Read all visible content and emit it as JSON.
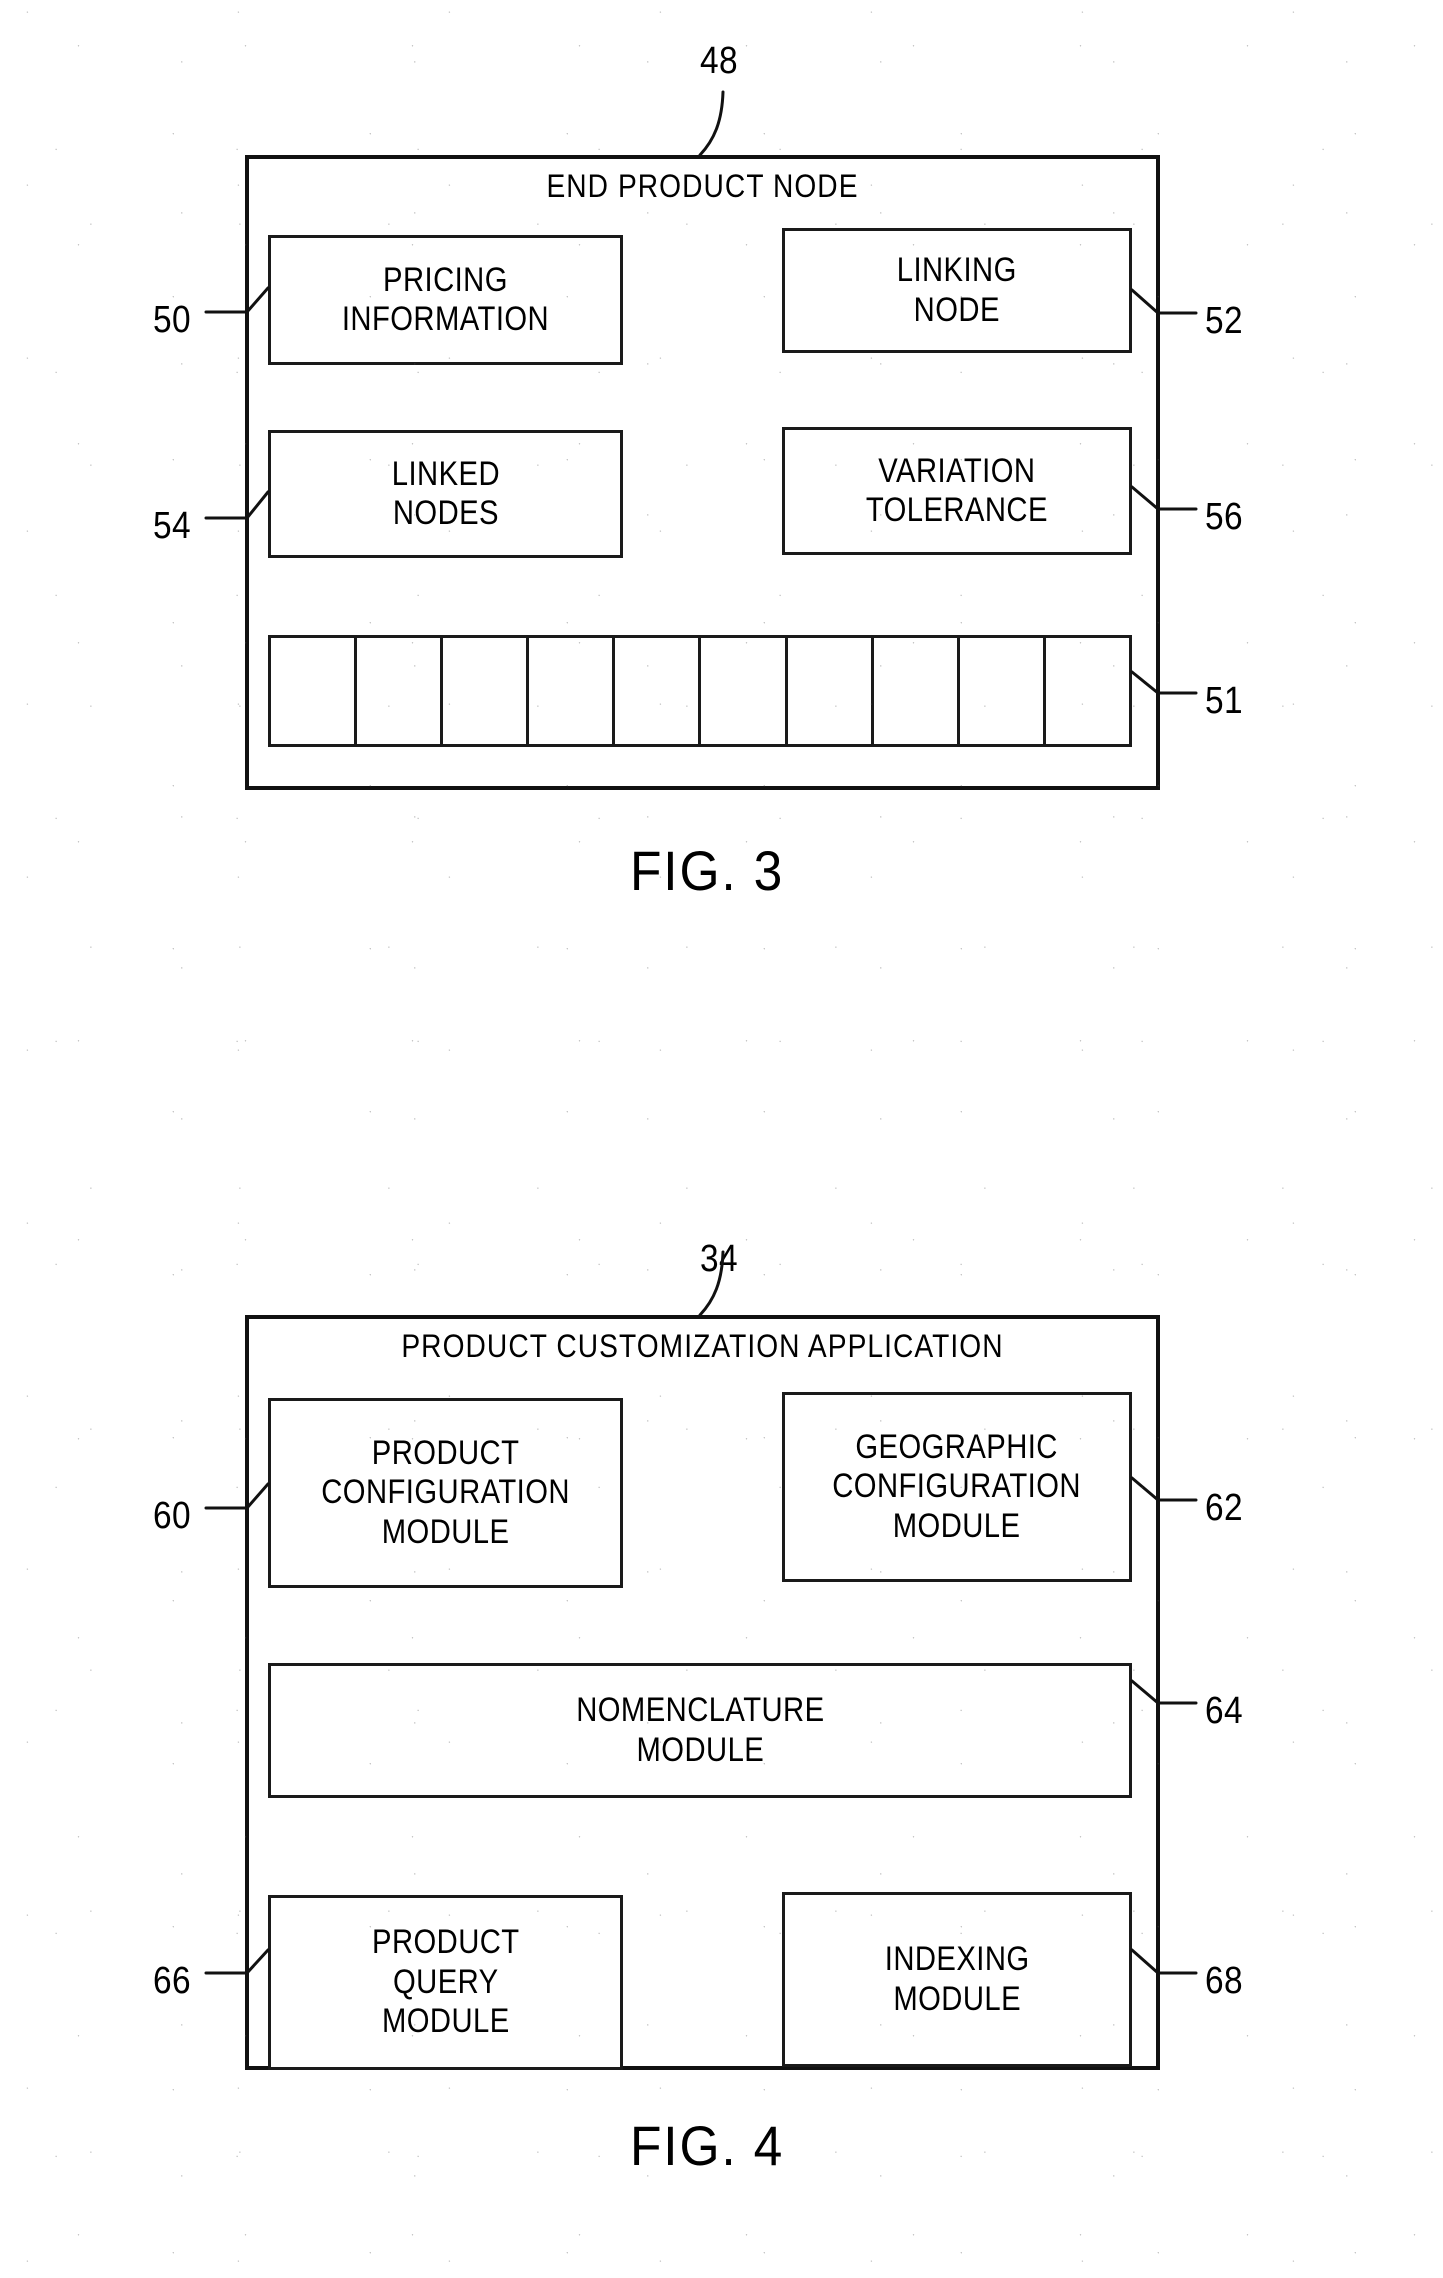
{
  "document": {
    "type": "patent-drawing-sheet",
    "ink_color": "#111111",
    "background_color": "#ffffff"
  },
  "figures": [
    {
      "id": "fig3",
      "caption": "FIG. 3",
      "outer": {
        "ref": "48",
        "title": "END  PRODUCT  NODE"
      },
      "blocks": [
        {
          "ref": "50",
          "label": "PRICING\nINFORMATION",
          "ref_side": "left"
        },
        {
          "ref": "52",
          "label": "LINKING\nNODE",
          "ref_side": "right"
        },
        {
          "ref": "54",
          "label": "LINKED\nNODES",
          "ref_side": "left"
        },
        {
          "ref": "56",
          "label": "VARIATION\nTOLERANCE",
          "ref_side": "right"
        }
      ],
      "cell_strip": {
        "ref": "51",
        "label": "",
        "cell_count": 10,
        "cells": [
          "",
          "",
          "",
          "",
          "",
          "",
          "",
          "",
          "",
          ""
        ]
      }
    },
    {
      "id": "fig4",
      "caption": "FIG. 4",
      "outer": {
        "ref": "34",
        "title": "PRODUCT  CUSTOMIZATION  APPLICATION"
      },
      "blocks": [
        {
          "ref": "60",
          "label": "PRODUCT\nCONFIGURATION\nMODULE",
          "ref_side": "left"
        },
        {
          "ref": "62",
          "label": "GEOGRAPHIC\nCONFIGURATION\nMODULE",
          "ref_side": "right"
        },
        {
          "ref": "64",
          "label": "NOMENCLATURE\nMODULE",
          "ref_side": "right"
        },
        {
          "ref": "66",
          "label": "PRODUCT\nQUERY\nMODULE",
          "ref_side": "left"
        },
        {
          "ref": "68",
          "label": "INDEXING\nMODULE",
          "ref_side": "right"
        }
      ]
    }
  ]
}
